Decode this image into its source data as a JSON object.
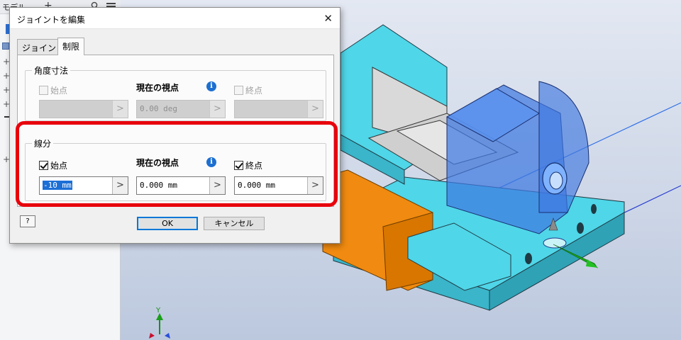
{
  "browser": {
    "tab_label": "モデル",
    "plus": "+"
  },
  "triad": {
    "y_label": "Y"
  },
  "dialog": {
    "title": "ジョイントを編集",
    "close_glyph": "✕",
    "tabs": [
      {
        "label": "ジョイント",
        "active": false
      },
      {
        "label": "制限",
        "active": true
      }
    ],
    "angle_group": {
      "title": "角度寸法",
      "start_label": "始点",
      "start_checked": false,
      "current_label": "現在の視点",
      "current_value": "0.00 deg",
      "end_label": "終点",
      "end_checked": false,
      "start_value": "",
      "end_value": ""
    },
    "linear_group": {
      "title": "線分",
      "start_label": "始点",
      "start_checked": true,
      "start_value": "-10 mm",
      "current_label": "現在の視点",
      "current_value": "0.000 mm",
      "end_label": "終点",
      "end_checked": true,
      "end_value": "0.000 mm"
    },
    "info_glyph": "i",
    "arrow_glyph": ">",
    "help_glyph": "?",
    "ok_label": "OK",
    "cancel_label": "キャンセル"
  },
  "colors": {
    "highlight": "#e8000c",
    "part_cyan": "#4fd6e8",
    "part_orange": "#f08a10",
    "part_blue_translucent": "#3f78e0",
    "info_blue": "#1d6fd1"
  }
}
